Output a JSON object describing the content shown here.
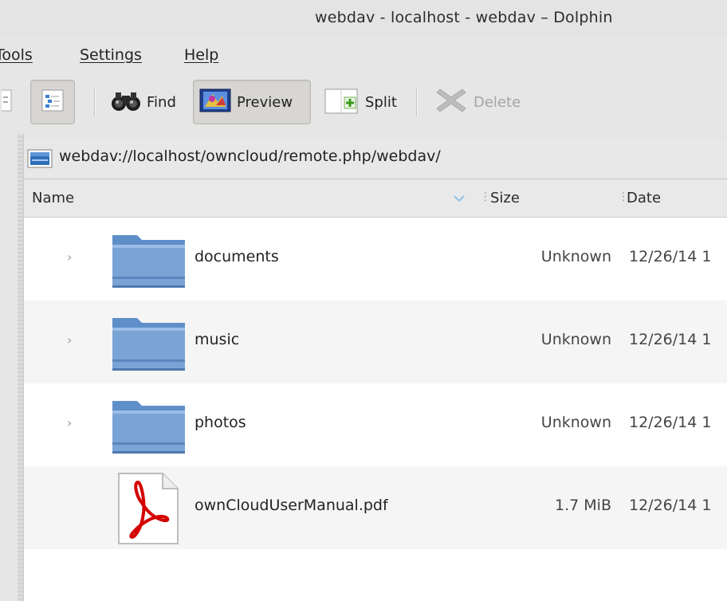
{
  "window": {
    "title": "webdav - localhost - webdav – Dolphin"
  },
  "menu": [
    {
      "label": "Tools"
    },
    {
      "label": "Settings"
    },
    {
      "label": "Help"
    }
  ],
  "toolbar": {
    "find": "Find",
    "preview": "Preview",
    "split": "Split",
    "delete": "Delete"
  },
  "location": {
    "url": "webdav://localhost/owncloud/remote.php/webdav/"
  },
  "columns": {
    "name": "Name",
    "size": "Size",
    "date": "Date"
  },
  "files": [
    {
      "name": "documents",
      "size": "Unknown",
      "date": "12/26/14 1",
      "type": "folder-icon"
    },
    {
      "name": "music",
      "size": "Unknown",
      "date": "12/26/14 1",
      "type": "folder-icon"
    },
    {
      "name": "photos",
      "size": "Unknown",
      "date": "12/26/14 1",
      "type": "folder-icon"
    },
    {
      "name": "ownCloudUserManual.pdf",
      "size": "1.7 MiB",
      "date": "12/26/14 1",
      "type": "pdf-icon"
    }
  ],
  "colors": {
    "folder": "#7aa3d6",
    "pdf_accent": "#d40000",
    "sort_arrow": "#8fc2ea"
  }
}
